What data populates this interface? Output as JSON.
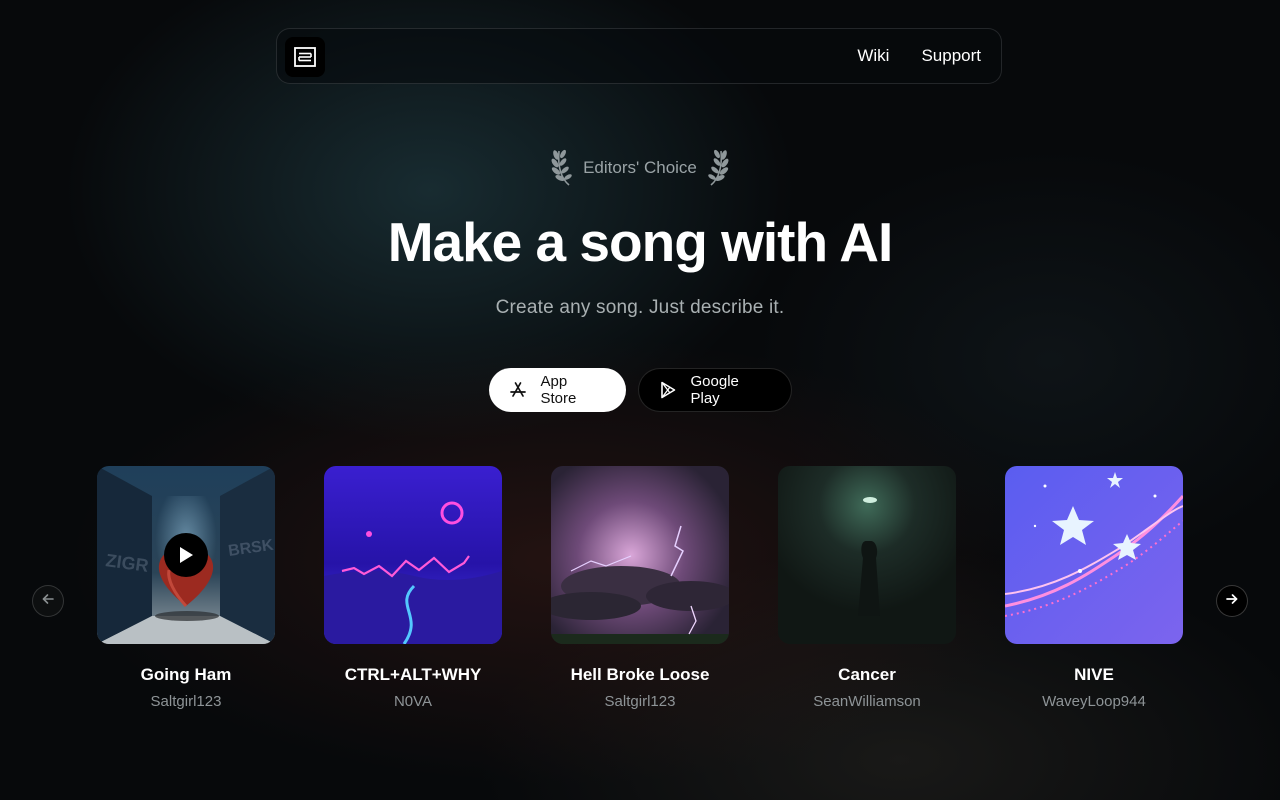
{
  "nav": {
    "logo_icon": "app-logo-icon",
    "links": [
      "Wiki",
      "Support"
    ]
  },
  "hero": {
    "award_text": "Editors' Choice",
    "award_icon": "laurel-icon",
    "title": "Make a song with AI",
    "subtitle": "Create any song. Just describe it."
  },
  "store_buttons": {
    "app_store": {
      "label": "App Store",
      "icon": "app-store-icon"
    },
    "google_play": {
      "label": "Google Play",
      "icon": "google-play-icon"
    }
  },
  "songs": [
    {
      "title": "Going Ham",
      "artist": "Saltgirl123",
      "playing": false
    },
    {
      "title": "CTRL+ALT+WHY",
      "artist": "N0VA"
    },
    {
      "title": "Hell Broke Loose",
      "artist": "Saltgirl123"
    },
    {
      "title": "Cancer",
      "artist": "SeanWilliamson"
    },
    {
      "title": "NIVE",
      "artist": "WaveyLoop944"
    }
  ],
  "carousel": {
    "prev_icon": "arrow-left-icon",
    "next_icon": "arrow-right-icon"
  },
  "colors": {
    "background": "#07090b",
    "accent_white": "#ffffff",
    "muted_text": "#8e9497"
  }
}
